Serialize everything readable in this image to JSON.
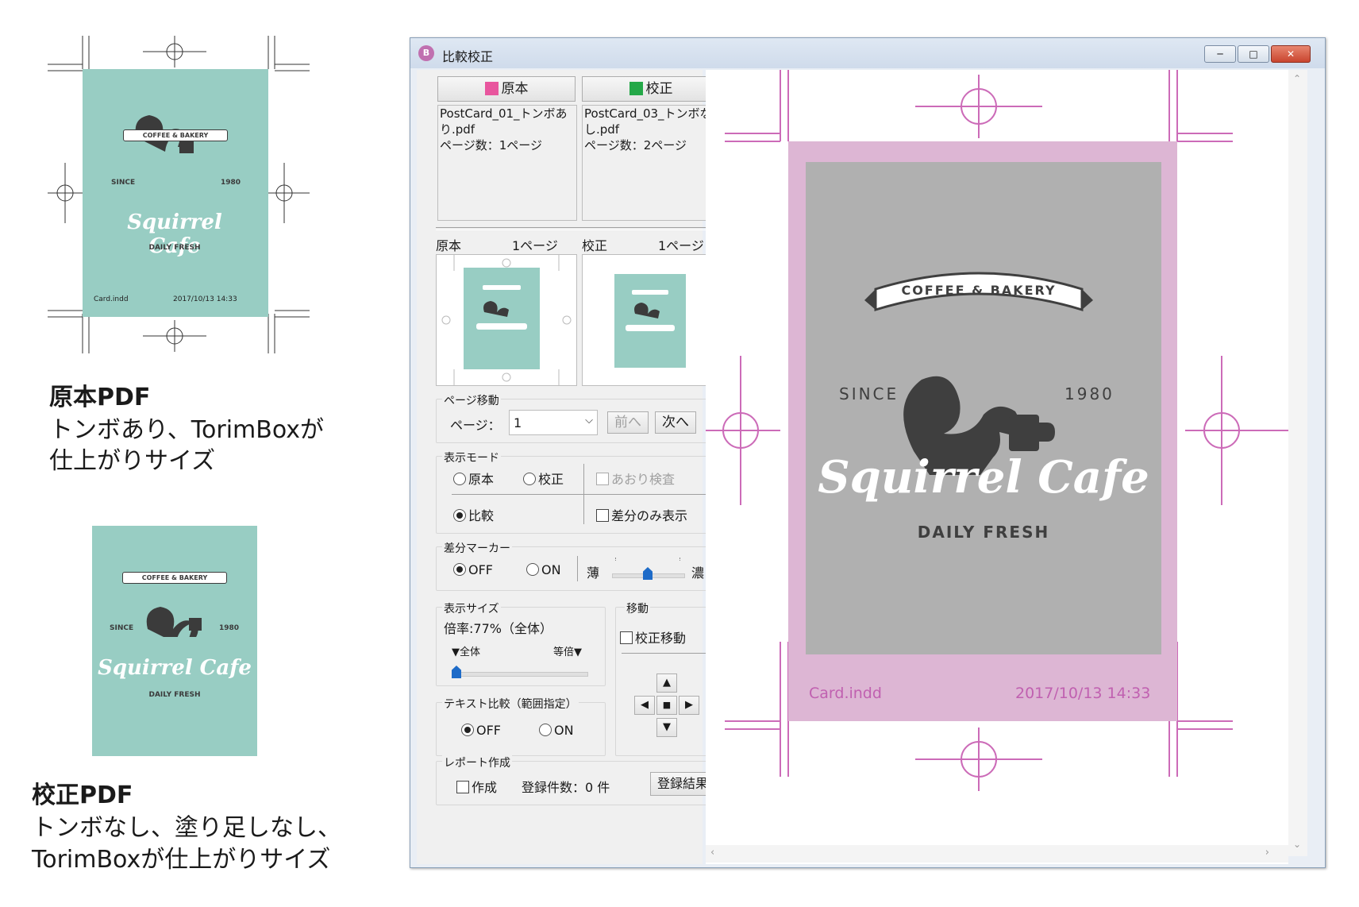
{
  "left": {
    "original_card": {
      "brand": "Squirrel Cafe",
      "banner": "COFFEE & BAKERY",
      "since": "SINCE",
      "year": "1980",
      "tagline": "DAILY FRESH",
      "slug_file": "Card.indd",
      "slug_date": "2017/10/13 14:33"
    },
    "original_caption": {
      "title": "原本PDF",
      "line1": "トンボあり、TorimBoxが",
      "line2": "仕上がりサイズ"
    },
    "proof_card": {
      "brand": "Squirrel Cafe",
      "banner": "COFFEE & BAKERY",
      "since": "SINCE",
      "year": "1980",
      "tagline": "DAILY FRESH"
    },
    "proof_caption": {
      "title": "校正PDF",
      "line1": "トンボなし、塗り足しなし、",
      "line2": "TorimBoxが仕上がりサイズ"
    }
  },
  "window": {
    "title": "比較校正",
    "app_icon": "app-logo-icon",
    "controls": {
      "minimize": "─",
      "maximize": "□",
      "close": "✕"
    }
  },
  "panel": {
    "original_button": "原本",
    "proof_button": "校正",
    "original_color": "#e8569e",
    "proof_color": "#24a848",
    "original_info": {
      "file": "PostCard_01_トンボあり.pdf",
      "pages": "ページ数：1ページ"
    },
    "proof_info": {
      "file": "PostCard_03_トンボなし.pdf",
      "pages": "ページ数：2ページ"
    },
    "thumb_original_label": "原本",
    "thumb_original_page": "1ページ",
    "thumb_proof_label": "校正",
    "thumb_proof_page": "1ページ",
    "page_nav": {
      "group": "ページ移動",
      "label": "ページ：",
      "value": "1",
      "prev": "前へ",
      "next": "次へ"
    },
    "display_mode": {
      "group": "表示モード",
      "original": "原本",
      "proof": "校正",
      "overlay": "あおり検査",
      "compare": "比較",
      "diff_only": "差分のみ表示"
    },
    "diff_marker": {
      "group": "差分マーカー",
      "off": "OFF",
      "on": "ON",
      "light": "薄",
      "dark": "濃",
      "level": 0.5
    },
    "display_size": {
      "group": "表示サイズ",
      "zoom": "倍率:77%（全体）",
      "fit": "▼全体",
      "actual": "等倍▼",
      "level": 0.0
    },
    "move": {
      "group": "移動",
      "proof_move": "校正移動"
    },
    "text_compare": {
      "group": "テキスト比較（範囲指定）",
      "off": "OFF",
      "on": "ON"
    },
    "report": {
      "group": "レポート作成",
      "create": "作成",
      "count": "登録件数：0 件",
      "results": "登録結果"
    }
  },
  "viewer": {
    "banner": "COFFEE & BAKERY",
    "since": "SINCE",
    "year": "1980",
    "brand": "Squirrel Cafe",
    "tagline": "DAILY FRESH",
    "slug_file": "Card.indd",
    "slug_date": "2017/10/13 14:33",
    "colors": {
      "bleed": "#ddb6d4",
      "page": "#b0b0b0",
      "marks": "#cc6bb8"
    }
  }
}
